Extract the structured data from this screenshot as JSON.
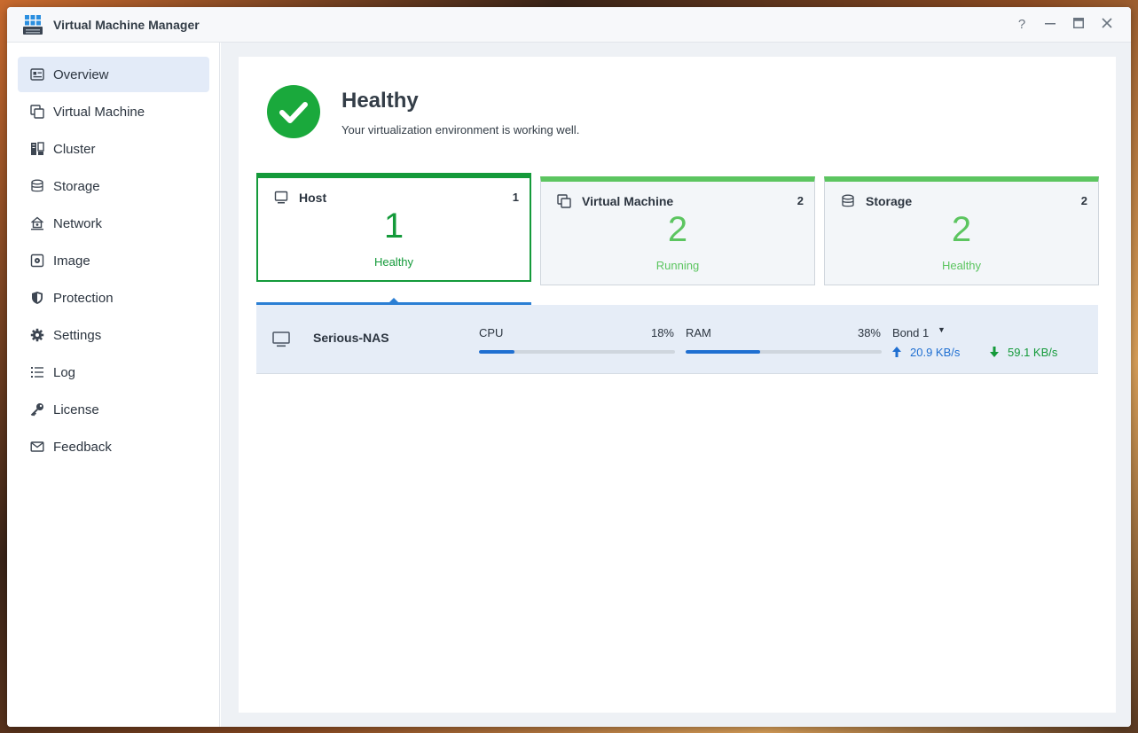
{
  "window": {
    "title": "Virtual Machine Manager",
    "controls": {
      "help": "?",
      "minimize": "—",
      "maximize": "▭",
      "close": "✕"
    }
  },
  "sidebar": {
    "items": [
      {
        "label": "Overview",
        "icon": "overview-icon",
        "active": true
      },
      {
        "label": "Virtual Machine",
        "icon": "virtual-machine-icon"
      },
      {
        "label": "Cluster",
        "icon": "cluster-icon"
      },
      {
        "label": "Storage",
        "icon": "storage-icon"
      },
      {
        "label": "Network",
        "icon": "network-icon"
      },
      {
        "label": "Image",
        "icon": "image-icon"
      },
      {
        "label": "Protection",
        "icon": "shield-icon"
      },
      {
        "label": "Settings",
        "icon": "gear-icon"
      },
      {
        "label": "Log",
        "icon": "list-icon"
      },
      {
        "label": "License",
        "icon": "key-icon"
      },
      {
        "label": "Feedback",
        "icon": "mail-icon"
      }
    ]
  },
  "health": {
    "title": "Healthy",
    "description": "Your virtualization environment is working well.",
    "color": "#1aa93c"
  },
  "cards": [
    {
      "title": "Host",
      "count": "1",
      "big": "1",
      "status": "Healthy",
      "icon": "monitor-icon",
      "selected": true
    },
    {
      "title": "Virtual Machine",
      "count": "2",
      "big": "2",
      "status": "Running",
      "icon": "virtual-machine-icon"
    },
    {
      "title": "Storage",
      "count": "2",
      "big": "2",
      "status": "Healthy",
      "icon": "storage-icon"
    }
  ],
  "host_row": {
    "name": "Serious-NAS",
    "cpu": {
      "label": "CPU",
      "value": "18%",
      "fraction": 0.18
    },
    "ram": {
      "label": "RAM",
      "value": "38%",
      "fraction": 0.38
    },
    "network": {
      "label": "Bond 1",
      "upload": "20.9 KB/s",
      "download": "59.1 KB/s"
    }
  },
  "colors": {
    "accent": "#1f6fd1",
    "healthy": "#149a3a",
    "light_green": "#5cc560"
  }
}
